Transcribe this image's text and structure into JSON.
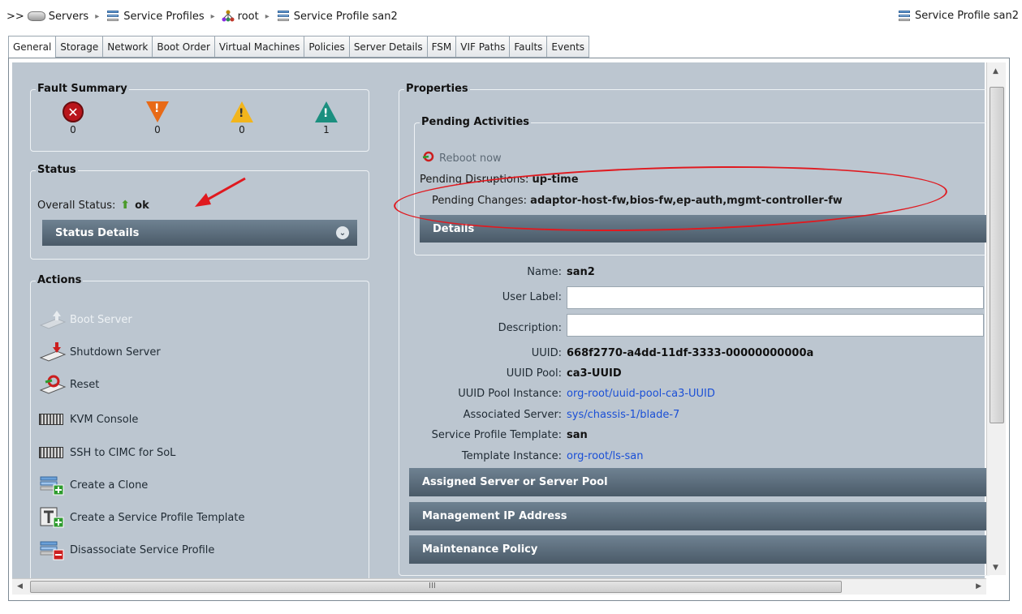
{
  "breadcrumb": {
    "expand": ">>",
    "items": [
      "Servers",
      "Service Profiles",
      "root",
      "Service Profile san2"
    ],
    "right_title": "Service Profile san2"
  },
  "tabs": [
    "General",
    "Storage",
    "Network",
    "Boot Order",
    "Virtual Machines",
    "Policies",
    "Server Details",
    "FSM",
    "VIF Paths",
    "Faults",
    "Events"
  ],
  "active_tab": "General",
  "fault_summary": {
    "title": "Fault Summary",
    "counts": {
      "critical": "0",
      "major": "0",
      "minor": "0",
      "warning": "1"
    }
  },
  "status": {
    "title": "Status",
    "overall_label": "Overall Status:",
    "overall_value": "ok",
    "details_label": "Status Details"
  },
  "actions": {
    "title": "Actions",
    "items": [
      "Boot Server",
      "Shutdown Server",
      "Reset",
      "KVM Console",
      "SSH to CIMC for SoL",
      "Create a Clone",
      "Create a Service Profile Template",
      "Disassociate Service Profile"
    ]
  },
  "properties": {
    "title": "Properties",
    "pending": {
      "title": "Pending Activities",
      "reboot_label": "Reboot now",
      "disruptions_label": "Pending Disruptions:",
      "disruptions_value": "up-time",
      "changes_label": "Pending Changes:",
      "changes_value": "adaptor-host-fw,bios-fw,ep-auth,mgmt-controller-fw",
      "details_label": "Details"
    },
    "name_label": "Name:",
    "name_value": "san2",
    "user_label_label": "User Label:",
    "user_label_value": "",
    "description_label": "Description:",
    "description_value": "",
    "uuid_label": "UUID:",
    "uuid_value": "668f2770-a4dd-11df-3333-00000000000a",
    "uuid_pool_label": "UUID Pool:",
    "uuid_pool_value": "ca3-UUID",
    "uuid_pool_instance_label": "UUID Pool Instance:",
    "uuid_pool_instance_value": "org-root/uuid-pool-ca3-UUID",
    "associated_server_label": "Associated Server:",
    "associated_server_value": "sys/chassis-1/blade-7",
    "sp_template_label": "Service Profile Template:",
    "sp_template_value": "san",
    "template_instance_label": "Template Instance:",
    "template_instance_value": "org-root/ls-san",
    "sections": [
      "Assigned Server or Server Pool",
      "Management IP Address",
      "Maintenance Policy"
    ]
  },
  "scroll": {
    "hthumb_glyph": "III"
  },
  "colors": {
    "panel": "#bcc6d0",
    "bar": "#4a5a68",
    "link": "#1a4fd6",
    "annotation": "#e0191f"
  }
}
